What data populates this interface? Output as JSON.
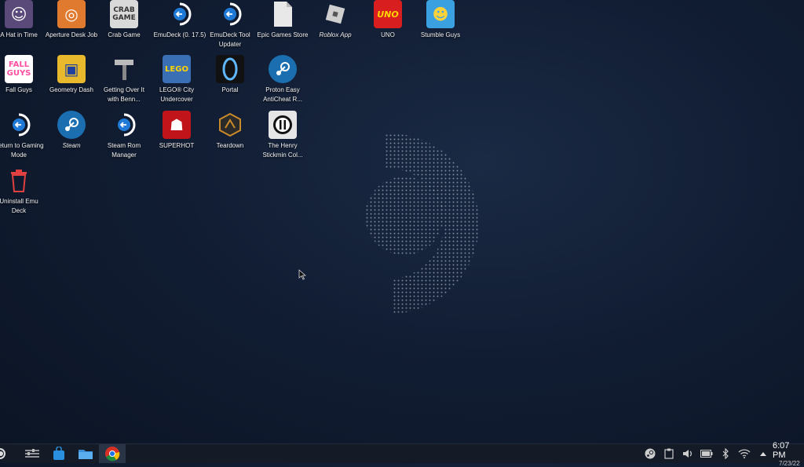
{
  "desktop": {
    "icons": [
      {
        "label": "A Hat in Time",
        "name": "a-hat-in-time-icon",
        "color": "#5a4a7a"
      },
      {
        "label": "Aperture Desk Job",
        "name": "aperture-desk-job-icon",
        "color": "#e07a2e"
      },
      {
        "label": "Crab Game",
        "name": "crab-game-icon",
        "color": "#d9d9d9"
      },
      {
        "label": "EmuDeck (0. 17.5)",
        "name": "emudeck-icon",
        "color": "#ffffff"
      },
      {
        "label": "EmuDeck Tool Updater",
        "name": "emudeck-updater-icon",
        "color": "#ffffff"
      },
      {
        "label": "Epic Games Store",
        "name": "epic-games-store-icon",
        "color": "#e8e8e8"
      },
      {
        "label": "Roblox App",
        "name": "roblox-icon",
        "color": "#bfbfbf"
      },
      {
        "label": "UNO",
        "name": "uno-icon",
        "color": "#d81e1e"
      },
      {
        "label": "Stumble Guys",
        "name": "stumble-guys-icon",
        "color": "#3aa0e0"
      },
      {
        "label": "Fall Guys",
        "name": "fall-guys-icon",
        "color": "#ff4fa3"
      },
      {
        "label": "Geometry Dash",
        "name": "geometry-dash-icon",
        "color": "#e8b92c"
      },
      {
        "label": "Getting Over It with Benn...",
        "name": "getting-over-it-icon",
        "color": "#555555"
      },
      {
        "label": "LEGO® City Undercover",
        "name": "lego-city-icon",
        "color": "#3b6fb5"
      },
      {
        "label": "Portal",
        "name": "portal-icon",
        "color": "#111111"
      },
      {
        "label": "Proton Easy AntiCheat R...",
        "name": "steam-icon",
        "color": "#1b6fb0"
      },
      {
        "label": "Return to Gaming Mode",
        "name": "return-gaming-mode-icon",
        "color": "#ffffff"
      },
      {
        "label": "Steam",
        "name": "steam-icon",
        "color": "#1b6fb0"
      },
      {
        "label": "Steam Rom Manager",
        "name": "steam-rom-manager-icon",
        "color": "#ffffff"
      },
      {
        "label": "SUPERHOT",
        "name": "superhot-icon",
        "color": "#c0141a"
      },
      {
        "label": "Teardown",
        "name": "teardown-icon",
        "color": "#c98a2a"
      },
      {
        "label": "The Henry Stickmin Col...",
        "name": "henry-stickmin-icon",
        "color": "#e6e6e6"
      },
      {
        "label": "Uninstall Emu Deck",
        "name": "trash-icon",
        "color": "#e04040"
      }
    ]
  },
  "taskbar": {
    "clock_time": "6:07 PM",
    "clock_date": "7/23/22"
  }
}
